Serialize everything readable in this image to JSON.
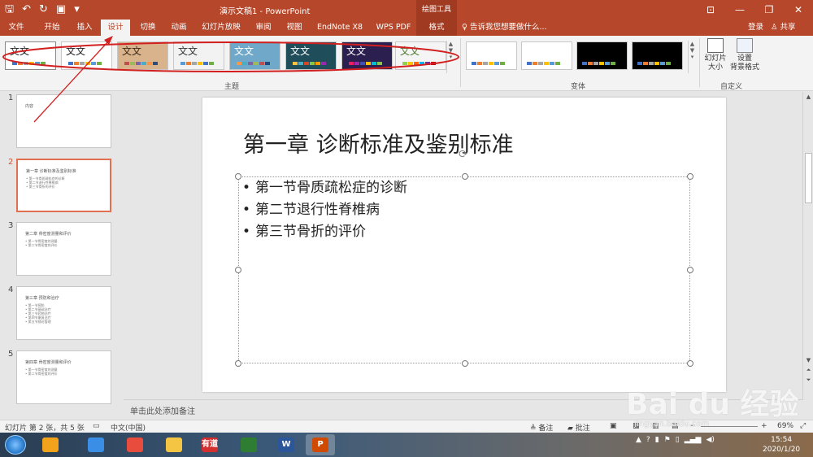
{
  "window": {
    "title": "演示文稿1 - PowerPoint",
    "contextual_tab_group": "绘图工具",
    "qat": [
      "save-icon",
      "undo-icon",
      "redo-icon",
      "present-icon",
      "more-icon"
    ]
  },
  "tabs": [
    "文件",
    "开始",
    "插入",
    "设计",
    "切换",
    "动画",
    "幻灯片放映",
    "审阅",
    "视图",
    "EndNote X8",
    "WPS PDF",
    "格式"
  ],
  "active_tab": "设计",
  "tell_me": "告诉我您想要做什么...",
  "login": "登录",
  "share": "共享",
  "ribbon": {
    "themes_label": "主题",
    "variants_label": "变体",
    "customize_label": "自定义",
    "theme_sample_text": "文文",
    "slide_size_label": "幻灯片\n大小",
    "format_bg_label": "设置\n背景格式",
    "themes": [
      {
        "bg": "#ffffff",
        "text": "#222222",
        "bars": [
          "#4472c4",
          "#ed7d31",
          "#a5a5a5",
          "#ffc000",
          "#5b9bd5",
          "#70ad47"
        ]
      },
      {
        "bg": "#ffffff",
        "text": "#222222",
        "bars": [
          "#4472c4",
          "#ed7d31",
          "#a5a5a5",
          "#ffc000",
          "#5b9bd5",
          "#70ad47"
        ]
      },
      {
        "bg": "#d9b38c",
        "text": "#3a2a18",
        "bars": [
          "#c0504d",
          "#9bbb59",
          "#8064a2",
          "#4bacc6",
          "#f79646",
          "#2c4d75"
        ]
      },
      {
        "bg": "#f2f2f2",
        "text": "#333333",
        "bars": [
          "#5b9bd5",
          "#ed7d31",
          "#a5a5a5",
          "#ffc000",
          "#4472c4",
          "#70ad47"
        ]
      },
      {
        "bg": "#6fa8c8",
        "text": "#ffffff",
        "bars": [
          "#f79646",
          "#4bacc6",
          "#8064a2",
          "#9bbb59",
          "#c0504d",
          "#1f497d"
        ]
      },
      {
        "bg": "#1f4e5a",
        "text": "#ffffff",
        "bars": [
          "#f5c242",
          "#4bacc6",
          "#d24726",
          "#8bc34a",
          "#ff9800",
          "#9c27b0"
        ]
      },
      {
        "bg": "#2a1f4f",
        "text": "#ffffff",
        "bars": [
          "#e91e63",
          "#9c27b0",
          "#3f51b5",
          "#ffc107",
          "#00bcd4",
          "#8bc34a"
        ]
      },
      {
        "bg": "#f5f5f5",
        "text": "#4a7a2a",
        "bars": [
          "#92d050",
          "#ffc000",
          "#ff6600",
          "#00b0f0",
          "#7030a0",
          "#c00000"
        ]
      }
    ],
    "variants": [
      {
        "bg": "#ffffff",
        "bars": [
          "#4472c4",
          "#ed7d31",
          "#a5a5a5",
          "#ffc000",
          "#5b9bd5",
          "#70ad47"
        ]
      },
      {
        "bg": "#ffffff",
        "bars": [
          "#4472c4",
          "#ed7d31",
          "#a5a5a5",
          "#ffc000",
          "#5b9bd5",
          "#70ad47"
        ]
      },
      {
        "bg": "#000000",
        "bars": [
          "#4472c4",
          "#ed7d31",
          "#a5a5a5",
          "#ffc000",
          "#5b9bd5",
          "#70ad47"
        ]
      },
      {
        "bg": "#000000",
        "bars": [
          "#4472c4",
          "#ed7d31",
          "#a5a5a5",
          "#ffc000",
          "#5b9bd5",
          "#70ad47"
        ]
      }
    ]
  },
  "thumbnails": [
    {
      "num": "1",
      "title": "内容",
      "lines": []
    },
    {
      "num": "2",
      "title": "第一章 诊断标准及鉴别标准",
      "lines": [
        "• 第一节骨质疏松症的诊断",
        "• 第二节退行性脊椎病",
        "• 第三节骨折的评价"
      ]
    },
    {
      "num": "3",
      "title": "第二章 骨密度测量和评价",
      "lines": [
        "• 第一节骨密度的测量",
        "• 第二节骨密度的评价"
      ]
    },
    {
      "num": "4",
      "title": "第三章 预防和治疗",
      "lines": [
        "• 第一节预防",
        "• 第二节基础治疗",
        "• 第三节药物治疗",
        "• 第四节康复治疗",
        "• 第五节随访管理"
      ]
    },
    {
      "num": "5",
      "title": "第四章 骨密度测量和评价",
      "lines": [
        "• 第一节骨密度的测量",
        "• 第二节骨密度的评价"
      ]
    }
  ],
  "slide": {
    "title": "第一章 诊断标准及鉴别标准",
    "bullets": [
      "第一节骨质疏松症的诊断",
      "第二节退行性脊椎病",
      "第三节骨折的评价"
    ]
  },
  "notes_placeholder": "单击此处添加备注",
  "status": {
    "slide_info": "幻灯片 第 2 张，共 5 张",
    "language": "中文(中国)",
    "notes": "备注",
    "comments": "批注",
    "zoom": "69%"
  },
  "taskbar": {
    "apps": [
      {
        "name": "app-1",
        "color": "#f2a21b"
      },
      {
        "name": "sogou",
        "color": "#3a8ee6"
      },
      {
        "name": "chrome",
        "color": "#e84c3d"
      },
      {
        "name": "explorer",
        "color": "#f4c542"
      },
      {
        "name": "youdao",
        "color": "#d32f2f"
      },
      {
        "name": "app-6",
        "color": "#2e7d32"
      },
      {
        "name": "word",
        "color": "#2b579a"
      },
      {
        "name": "powerpoint",
        "color": "#d04a02"
      }
    ],
    "youdao_label": "有道",
    "word_label": "W",
    "ppt_label": "P",
    "time": "15:54",
    "date": "2020/1/20"
  },
  "watermark": {
    "big": "Bai du 经验",
    "small": "jingyan.baidu.com"
  },
  "colors": {
    "accent": "#b7472a",
    "annotation": "#d22020"
  }
}
